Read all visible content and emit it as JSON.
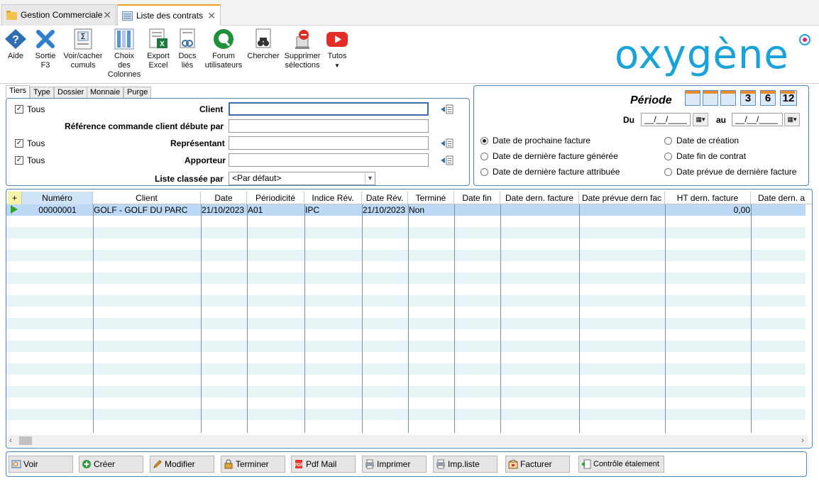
{
  "tabs": [
    {
      "label": "Gestion Commerciale",
      "active": false
    },
    {
      "label": "Liste des contrats",
      "active": true
    }
  ],
  "toolbar": {
    "aide": "Aide",
    "sortie": [
      "Sortie",
      "F3"
    ],
    "cumuls": [
      "Voir/cacher",
      "cumuls"
    ],
    "colonnes": [
      "Choix",
      "des",
      "Colonnes"
    ],
    "export": [
      "Export",
      "Excel"
    ],
    "docs": [
      "Docs",
      "liés"
    ],
    "forum": [
      "Forum",
      "utilisateurs"
    ],
    "chercher": "Chercher",
    "supprimer": [
      "Supprimer",
      "sélections"
    ],
    "tutos": "Tutos"
  },
  "logo": "oxygène",
  "filter_tabs": [
    "Tiers",
    "Type",
    "Dossier",
    "Monnaie",
    "Purge"
  ],
  "filters": {
    "client_all": "Tous",
    "client_label": "Client",
    "ref_label": "Référence commande client débute par",
    "rep_all": "Tous",
    "rep_label": "Représentant",
    "app_all": "Tous",
    "app_label": "Apporteur",
    "sort_label": "Liste classée par",
    "sort_value": "<Par défaut>"
  },
  "periode": {
    "title": "Période",
    "calendar_buttons": [
      "",
      "",
      "",
      "3",
      "6",
      "12"
    ],
    "du_label": "Du",
    "au_label": "au",
    "du_value": "__/__/____",
    "au_value": "__/__/____",
    "options": [
      {
        "label": "Date de prochaine facture",
        "selected": true
      },
      {
        "label": "Date de création",
        "selected": false
      },
      {
        "label": "Date de dernière facture générée",
        "selected": false
      },
      {
        "label": "Date fin de contrat",
        "selected": false
      },
      {
        "label": "Date de dernière facture attribuée",
        "selected": false
      },
      {
        "label": "Date prévue de dernière facture",
        "selected": false
      }
    ]
  },
  "grid": {
    "columns": [
      "Numéro",
      "Client",
      "Date",
      "Périodicité",
      "Indice Rév.",
      "Date Rév.",
      "Terminé",
      "Date fin",
      "Date dern. facture",
      "Date prévue dern fac",
      "HT dern. facture",
      "Date dern. a"
    ],
    "rows": [
      [
        "00000001",
        "GOLF - GOLF DU PARC",
        "21/10/2023",
        "A01",
        "IPC",
        "21/10/2023",
        "Non",
        "",
        "",
        "",
        "0,00",
        ""
      ]
    ]
  },
  "buttons": {
    "voir": "Voir",
    "creer": "Créer",
    "modifier": "Modifier",
    "terminer": "Terminer",
    "pdfmail": "Pdf Mail",
    "imprimer": "Imprimer",
    "impliste": "Imp.liste",
    "facturer": "Facturer",
    "controle": "Contrôle étalement"
  }
}
